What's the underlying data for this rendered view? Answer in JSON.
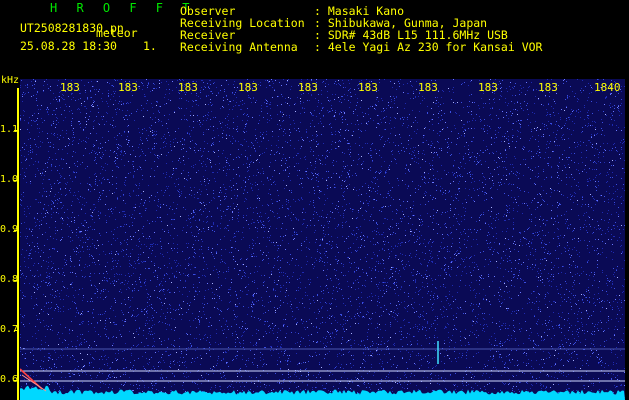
{
  "header": {
    "brand": "H R O F F T",
    "file_name": "UT2508281830.pn",
    "file_tag": "meteor",
    "timestamp": "25.08.28 18:30",
    "count": "1."
  },
  "meta": [
    {
      "label": "Observer",
      "value": ": Masaki Kano"
    },
    {
      "label": "Receiving Location",
      "value": ": Shibukawa, Gunma, Japan"
    },
    {
      "label": "Receiver",
      "value": ": SDR# 43dB L15 111.6MHz USB"
    },
    {
      "label": "Receiving Antenna",
      "value": ": 4ele Yagi Az 230 for Kansai VOR"
    }
  ],
  "axes": {
    "y_unit": "kHz",
    "x_ticks": [
      "183",
      "183",
      "183",
      "183",
      "183",
      "183",
      "183",
      "183",
      "183",
      "1840"
    ],
    "y_ticks": [
      "1.1",
      "1.0",
      "0.9",
      "0.8",
      "0.7",
      "0.6"
    ]
  },
  "colors": {
    "background": "#0a0a55",
    "text": "#ffff00",
    "brand": "#00e800",
    "noise": "#2a3cd0",
    "trace": "#00ffff",
    "meteor": "#ff4040"
  }
}
